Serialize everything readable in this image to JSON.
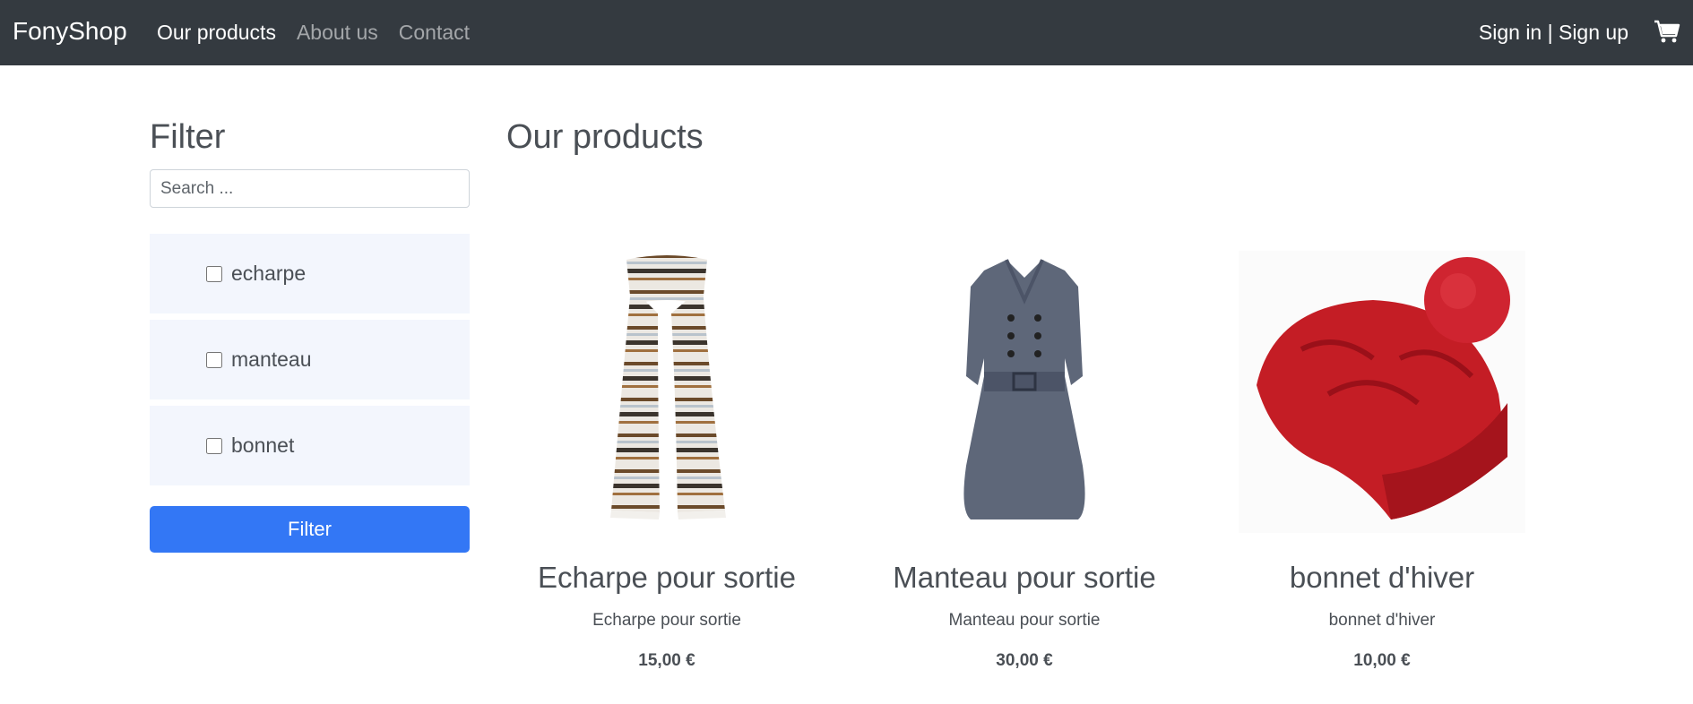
{
  "navbar": {
    "brand": "FonyShop",
    "links": [
      "Our products",
      "About us",
      "Contact"
    ],
    "sign_in": "Sign in",
    "separator": " | ",
    "sign_up": "Sign up",
    "cart_icon": "cart-icon"
  },
  "sidebar": {
    "title": "Filter",
    "search_placeholder": "Search ...",
    "categories": [
      "echarpe",
      "manteau",
      "bonnet"
    ],
    "filter_button": "Filter"
  },
  "main": {
    "title": "Our products",
    "products": [
      {
        "name": "Echarpe pour sortie",
        "description": "Echarpe pour sortie",
        "price": "15,00 €"
      },
      {
        "name": "Manteau pour sortie",
        "description": "Manteau pour sortie",
        "price": "30,00 €"
      },
      {
        "name": "bonnet d'hiver",
        "description": "bonnet d'hiver",
        "price": "10,00 €"
      }
    ]
  },
  "colors": {
    "navbar_bg": "#343a40",
    "primary_button": "#3377f5",
    "filter_item_bg": "#f3f6fd"
  }
}
